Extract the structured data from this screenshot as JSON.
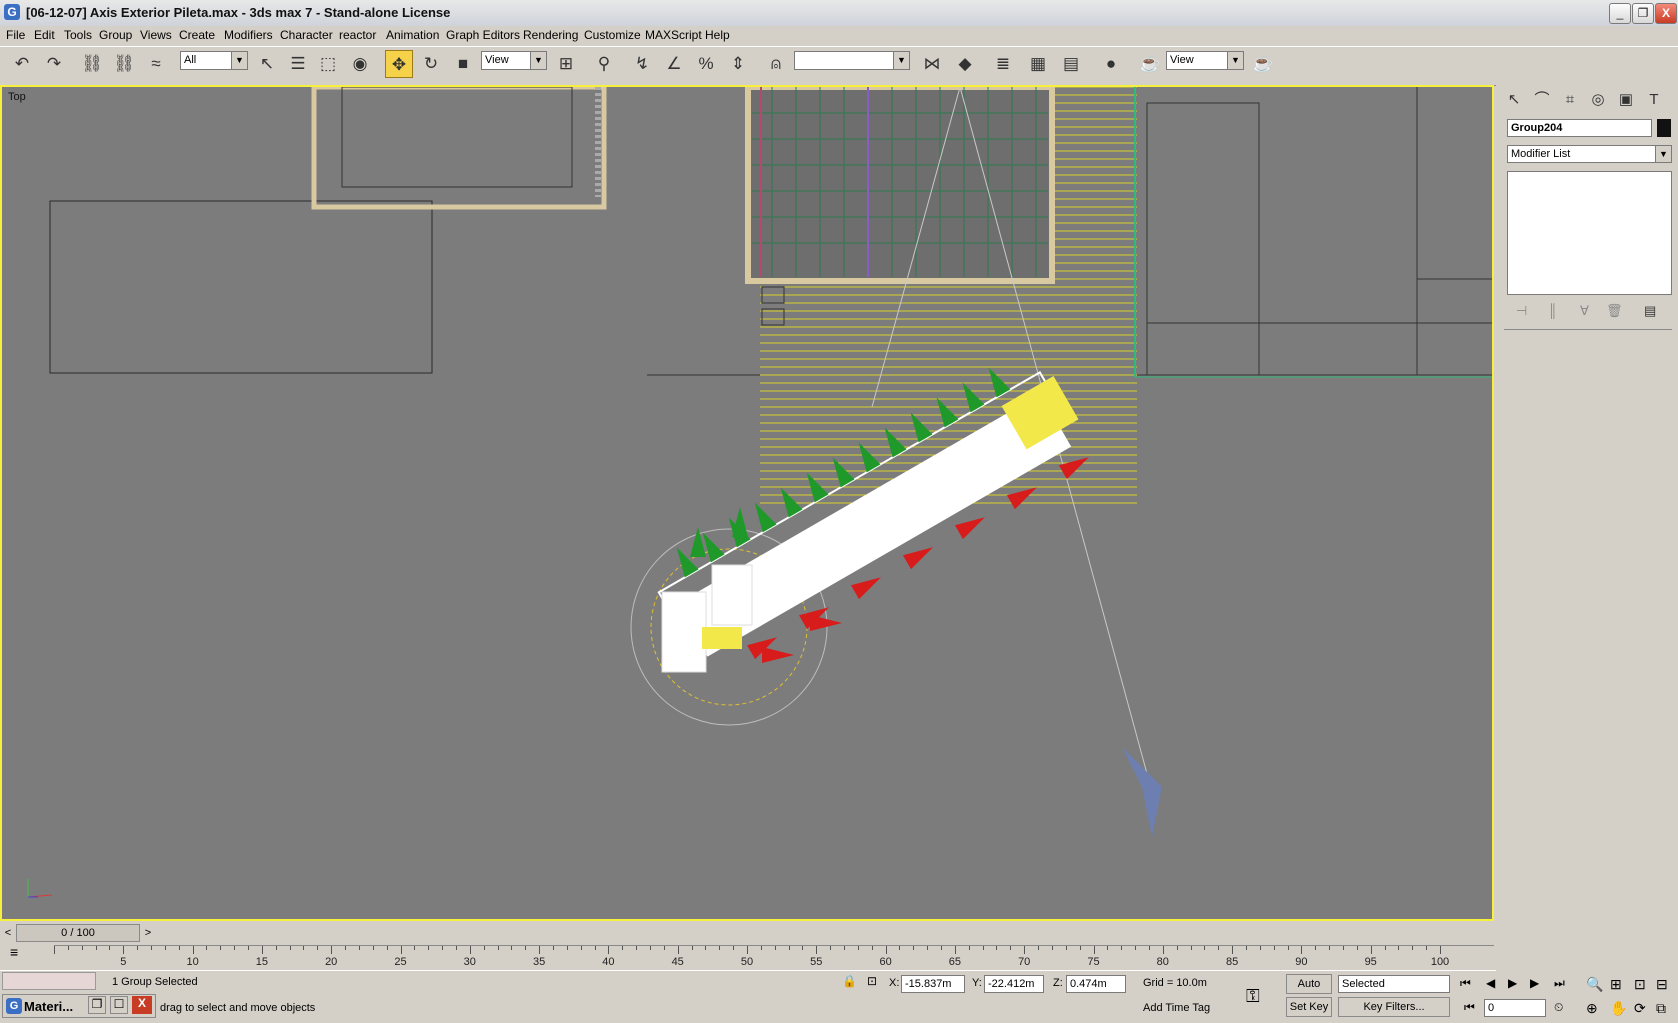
{
  "window": {
    "title": "[06-12-07] Axis Exterior Pileta.max - 3ds max 7  - Stand-alone License",
    "minimize": "_",
    "restore": "❐",
    "close": "X"
  },
  "menu": [
    "File",
    "Edit",
    "Tools",
    "Group",
    "Views",
    "Create",
    "Modifiers",
    "Character",
    "reactor",
    "Animation",
    "Graph Editors",
    "Rendering",
    "Customize",
    "MAXScript",
    "Help"
  ],
  "toolbar": {
    "selection_filter": "All",
    "ref_coord_1": "View",
    "ref_coord_2": "View",
    "named_selection": ""
  },
  "viewport": {
    "label": "Top",
    "border_color": "#f6ef3c",
    "background": "#7c7c7c"
  },
  "command_panel": {
    "object_name": "Group204",
    "object_color": "#111111",
    "modifier_list": "Modifier List"
  },
  "timeline": {
    "slider": "0 / 100",
    "ticks": [
      "5",
      "10",
      "15",
      "20",
      "25",
      "30",
      "35",
      "40",
      "45",
      "50",
      "55",
      "60",
      "65",
      "70",
      "75",
      "80",
      "85",
      "90",
      "95",
      "100"
    ]
  },
  "status": {
    "selection_count": "1 Group Selected",
    "prompt": "drag to select and move objects",
    "x_label": "X:",
    "x_value": "-15.837m",
    "y_label": "Y:",
    "y_value": "-22.412m",
    "z_label": "Z:",
    "z_value": "0.474m",
    "grid": "Grid = 10.0m",
    "add_time_tag": "Add Time Tag",
    "auto_key": "Auto Key",
    "set_key": "Set Key",
    "key_mode": "Selected",
    "key_filters": "Key Filters...",
    "frame": "0"
  },
  "taskbar": {
    "item": "Materi..."
  }
}
